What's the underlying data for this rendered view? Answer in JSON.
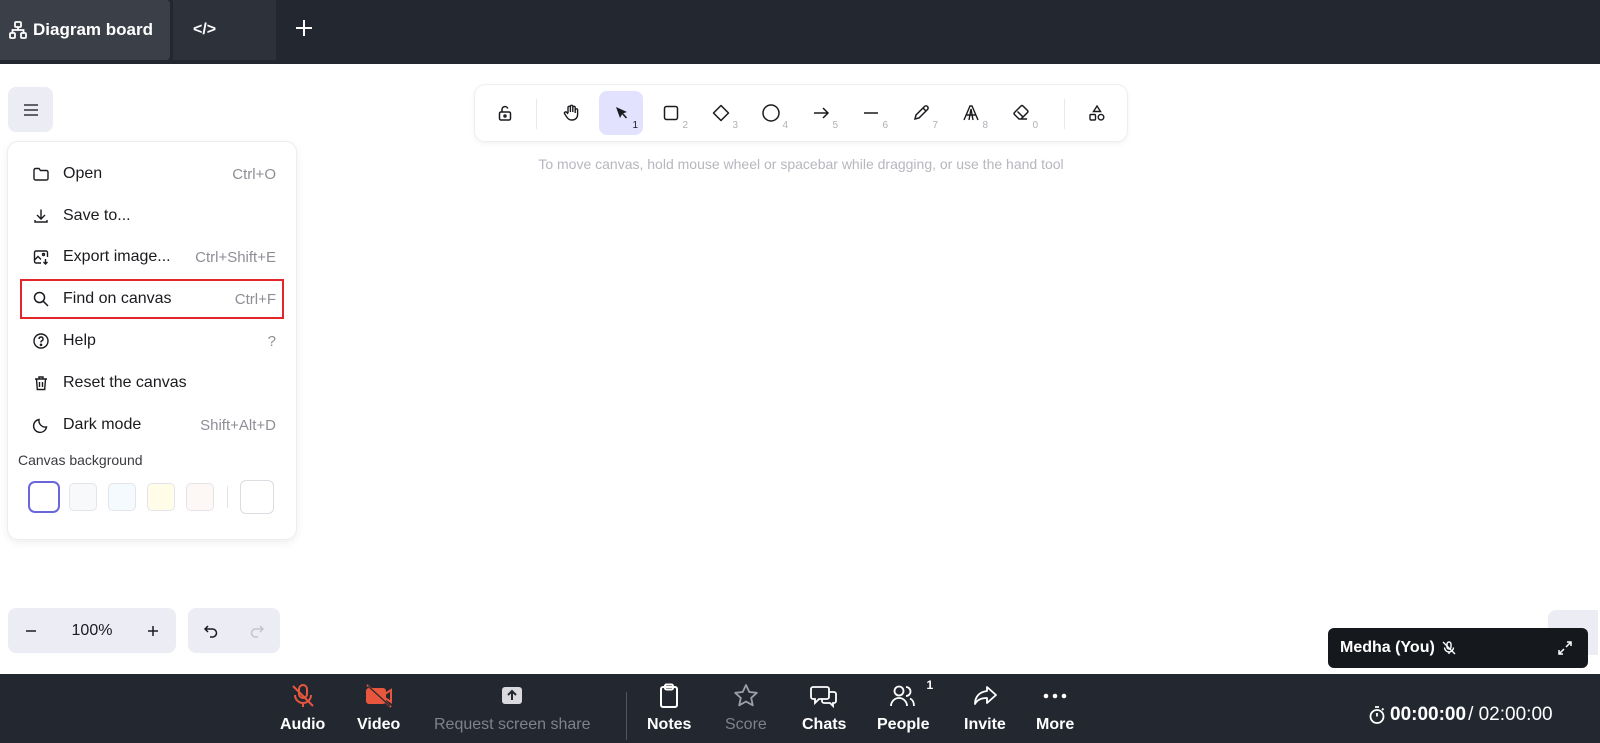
{
  "tabs": {
    "board_label": "Diagram board",
    "code_label": "</>",
    "add_label": "+"
  },
  "toolbar": {
    "tools": [
      {
        "name": "lock",
        "key": ""
      },
      {
        "name": "hand",
        "key": ""
      },
      {
        "name": "selection",
        "key": "1",
        "active": true
      },
      {
        "name": "rectangle",
        "key": "2"
      },
      {
        "name": "diamond",
        "key": "3"
      },
      {
        "name": "ellipse",
        "key": "4"
      },
      {
        "name": "arrow",
        "key": "5"
      },
      {
        "name": "line",
        "key": "6"
      },
      {
        "name": "draw",
        "key": "7"
      },
      {
        "name": "text",
        "key": "8"
      },
      {
        "name": "eraser",
        "key": "0"
      },
      {
        "name": "more-shapes",
        "key": ""
      }
    ],
    "hint": "To move canvas, hold mouse wheel or spacebar while dragging, or use the hand tool"
  },
  "menu": {
    "items": [
      {
        "label": "Open",
        "shortcut": "Ctrl+O",
        "icon": "folder-icon"
      },
      {
        "label": "Save to...",
        "shortcut": "",
        "icon": "download-icon"
      },
      {
        "label": "Export image...",
        "shortcut": "Ctrl+Shift+E",
        "icon": "export-image-icon"
      },
      {
        "label": "Find on canvas",
        "shortcut": "Ctrl+F",
        "icon": "search-icon",
        "highlighted": true
      },
      {
        "label": "Help",
        "shortcut": "?",
        "icon": "help-icon"
      },
      {
        "label": "Reset the canvas",
        "shortcut": "",
        "icon": "trash-icon"
      },
      {
        "label": "Dark mode",
        "shortcut": "Shift+Alt+D",
        "icon": "moon-icon"
      }
    ],
    "canvas_background_label": "Canvas background",
    "swatches": [
      "#ffffff",
      "#f8f9fa",
      "#f5faff",
      "#fffce8",
      "#fdf8f6"
    ],
    "highlight_color": "#e3262a"
  },
  "zoom": {
    "minus": "−",
    "value": "100%",
    "plus": "+"
  },
  "participant": {
    "name": "Medha (You)"
  },
  "bottombar": {
    "audio": "Audio",
    "video": "Video",
    "screen_share": "Request screen share",
    "notes": "Notes",
    "score": "Score",
    "chats": "Chats",
    "people": "People",
    "people_count": "1",
    "invite": "Invite",
    "more": "More",
    "timer_elapsed": "00:00:00",
    "timer_total": "/ 02:00:00"
  },
  "colors": {
    "accent": "#6965db",
    "active_tool_bg": "#e3e2fe",
    "muted_red": "#e8563d",
    "bar_bg": "#232830"
  }
}
